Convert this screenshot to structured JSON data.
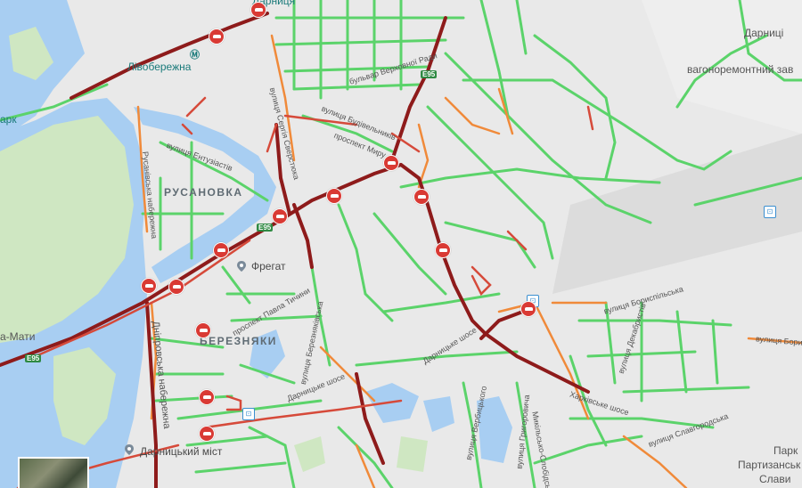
{
  "map": {
    "districts": {
      "rusanovka": "РУСАНОВКА",
      "bereznyaki": "БЕРЕЗНЯКИ"
    },
    "metro": {
      "livoberezhna": "Лівобережна",
      "darnytsia_top": "Дарниця",
      "park": "арк"
    },
    "places": {
      "darnytsia_plant_1": "Дарниці",
      "darnytsia_plant_2": "вагоноремонтний зав",
      "park_1": "Парк",
      "park_2": "Партизанськ",
      "park_3": "Слави",
      "mati": "а-Мати"
    },
    "pois": {
      "fregat": "Фрегат",
      "darnytskyi_bridge": "Дарницький міст"
    },
    "routes": {
      "e95_top": "E95",
      "e95_mid": "E95",
      "e95_left": "E95"
    },
    "streets": {
      "verkhovnoi_rady": "бульвар Верховної Ради",
      "budivelnykiv": "вулиця Будівельників",
      "myru": "проспект Миру",
      "serhiia_sverstiuka": "вулиця Сергія Сверстюка",
      "entuziastiv": "вулиця Ентузіастів",
      "rusanivska_nab": "Русанівська набережна",
      "pavla_tychyny": "проспект Павла Тичини",
      "berezniakivska": "вулиця Березняківська",
      "dniprovska_nab": "Дніпровська набережна",
      "darnytske_shose": "Дарницьке шосе",
      "kharkivske_shose": "Харківське шосе",
      "borysoglibska": "вулиця Бориспільська",
      "boryspilska_2": "вулиця Бориспі",
      "dekabrystiv": "вулиця Декабристів",
      "slavgorodska": "вулиця Славгородська",
      "yevhena_sverstiuka_2": "вулиця Вербицького",
      "hrygorovycha": "вулиця Григоровича",
      "mykilsko": "Микільсько-Слобідська"
    },
    "incident_count": 17
  }
}
